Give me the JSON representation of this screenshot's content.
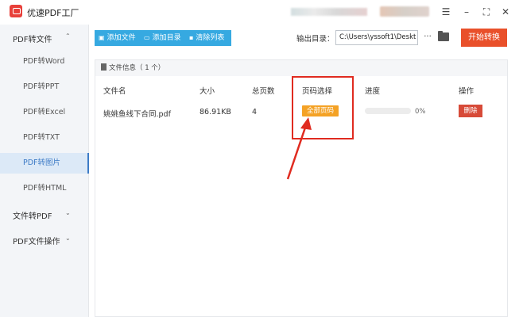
{
  "app": {
    "title": "优速PDF工厂"
  },
  "window_controls": {
    "menu": "☰",
    "minimize": "–",
    "maximize": "⛶"
  },
  "sidebar": {
    "groups": [
      {
        "label": "PDF转文件",
        "chevron": "^"
      },
      {
        "label": "文件转PDF",
        "chevron": "v"
      },
      {
        "label": "PDF文件操作",
        "chevron": "v"
      }
    ],
    "items": [
      {
        "label": "PDF转Word"
      },
      {
        "label": "PDF转PPT"
      },
      {
        "label": "PDF转Excel"
      },
      {
        "label": "PDF转TXT"
      },
      {
        "label": "PDF转图片",
        "active": true
      },
      {
        "label": "PDF转HTML"
      }
    ]
  },
  "toolbar": {
    "add_file": "添加文件",
    "add_dir": "添加目录",
    "clear_list": "清除列表",
    "output_label": "输出目录：",
    "output_path": "C:\\Users\\yssoft1\\Deskt",
    "more": "···",
    "start": "开始转换",
    "accent_color": "#36a9e1",
    "start_color": "#e9502a"
  },
  "panel": {
    "title": "文件信息（ 1 个）",
    "columns": [
      "文件名",
      "大小",
      "总页数",
      "页码选择",
      "进度",
      "操作"
    ],
    "rows": [
      {
        "filename": "姚姚鱼线下合同.pdf",
        "size": "86.91KB",
        "pages": "4",
        "page_select": "全部页码",
        "progress": "0%",
        "progress_value": 0,
        "action": "删除"
      }
    ]
  },
  "icons": {
    "app": "app-logo-icon",
    "add_file": "plus-icon",
    "add_dir": "folder-icon",
    "clear": "trash-icon",
    "browse": "folder-icon",
    "info": "document-icon"
  }
}
